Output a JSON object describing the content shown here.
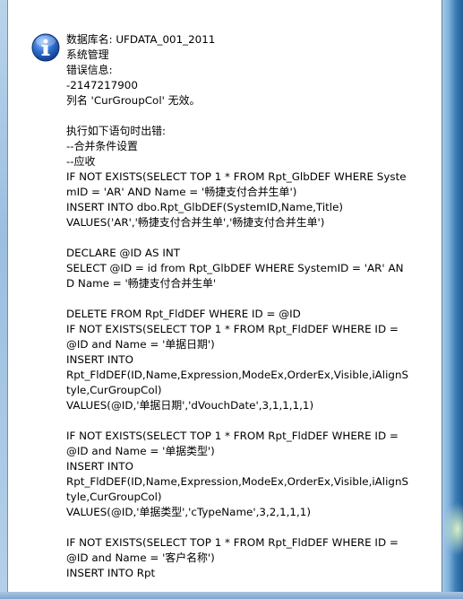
{
  "dialog": {
    "icon": "info-icon",
    "message": "数据库名: UFDATA_001_2011\n系统管理\n错误信息:\n-2147217900\n列名 'CurGroupCol' 无效。\n\n执行如下语句时出错:\n--合并条件设置\n--应收\nIF NOT EXISTS(SELECT TOP 1 * FROM Rpt_GlbDEF WHERE SystemID = 'AR' AND Name = '畅捷支付合并生单')\nINSERT INTO dbo.Rpt_GlbDEF(SystemID,Name,Title)\nVALUES('AR','畅捷支付合并生单','畅捷支付合并生单')\n\nDECLARE @ID AS INT\nSELECT @ID = id from Rpt_GlbDEF WHERE SystemID = 'AR' AND Name = '畅捷支付合并生单'\n\nDELETE FROM Rpt_FldDEF WHERE ID = @ID\nIF NOT EXISTS(SELECT TOP 1 * FROM Rpt_FldDEF WHERE ID = @ID and Name = '单据日期')\nINSERT INTO\nRpt_FldDEF(ID,Name,Expression,ModeEx,OrderEx,Visible,iAlignStyle,CurGroupCol)\nVALUES(@ID,'单据日期','dVouchDate',3,1,1,1,1)\n\nIF NOT EXISTS(SELECT TOP 1 * FROM Rpt_FldDEF WHERE ID = @ID and Name = '单据类型')\nINSERT INTO\nRpt_FldDEF(ID,Name,Expression,ModeEx,OrderEx,Visible,iAlignStyle,CurGroupCol)\nVALUES(@ID,'单据类型','cTypeName',3,2,1,1,1)\n\nIF NOT EXISTS(SELECT TOP 1 * FROM Rpt_FldDEF WHERE ID = @ID and Name = '客户名称')\nINSERT INTO Rpt"
  },
  "colors": {
    "icon_blue": "#2a5fb0",
    "frame_blue": "#7fa9cf"
  }
}
